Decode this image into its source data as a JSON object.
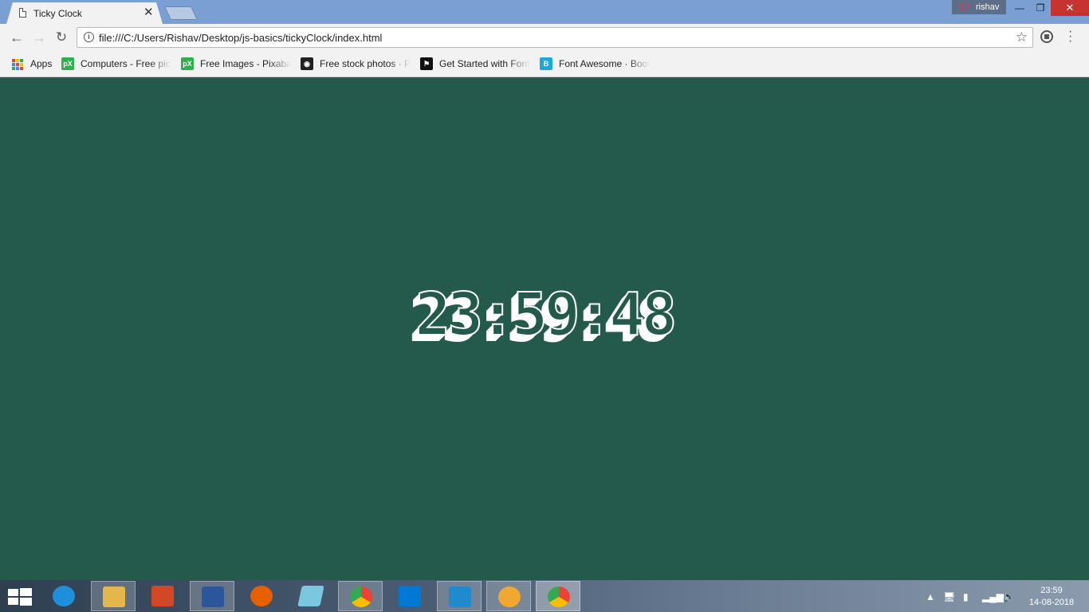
{
  "window": {
    "tab_title": "Ticky Clock",
    "tab_close": "✕",
    "profile_name": "rishav",
    "min": "—",
    "max": "❐",
    "close": "✕"
  },
  "toolbar": {
    "back": "←",
    "forward": "→",
    "reload": "↻",
    "info": "i",
    "url": "file:///C:/Users/Rishav/Desktop/js-basics/tickyClock/index.html",
    "star": "☆",
    "menu": "⋮"
  },
  "bookmarks": {
    "apps_label": "Apps",
    "items": [
      {
        "label": "Computers - Free pictures",
        "icon_text": "pX",
        "color": "#2bb24c"
      },
      {
        "label": "Free Images - Pixabay",
        "icon_text": "pX",
        "color": "#2bb24c"
      },
      {
        "label": "Free stock photos · Pexels",
        "icon_text": "◉",
        "color": "#222222"
      },
      {
        "label": "Get Started with Font Awesome",
        "icon_text": "⚑",
        "color": "#111111"
      },
      {
        "label": "Font Awesome · Bootstrap",
        "icon_text": "B",
        "color": "#1aa9d8"
      }
    ]
  },
  "page": {
    "clock_text": "23:59:48",
    "background_color": "#235a4b"
  },
  "taskbar": {
    "apps": [
      {
        "name": "internet-explorer",
        "color": "#1e8fd8"
      },
      {
        "name": "file-explorer",
        "color": "#e5b64c"
      },
      {
        "name": "powerpoint",
        "color": "#d24726"
      },
      {
        "name": "word",
        "color": "#2b579a"
      },
      {
        "name": "firefox",
        "color": "#e66000"
      },
      {
        "name": "notepad-crystal",
        "color": "#7ac7e0"
      },
      {
        "name": "chrome",
        "color": "#4285f4"
      },
      {
        "name": "vscode",
        "color": "#0078d4"
      },
      {
        "name": "brackets",
        "color": "#1f8ad0"
      },
      {
        "name": "paint",
        "color": "#f0a830"
      },
      {
        "name": "chrome-active",
        "color": "#4285f4"
      }
    ],
    "tray_time": "23:59",
    "tray_date": "14-08-2018"
  }
}
